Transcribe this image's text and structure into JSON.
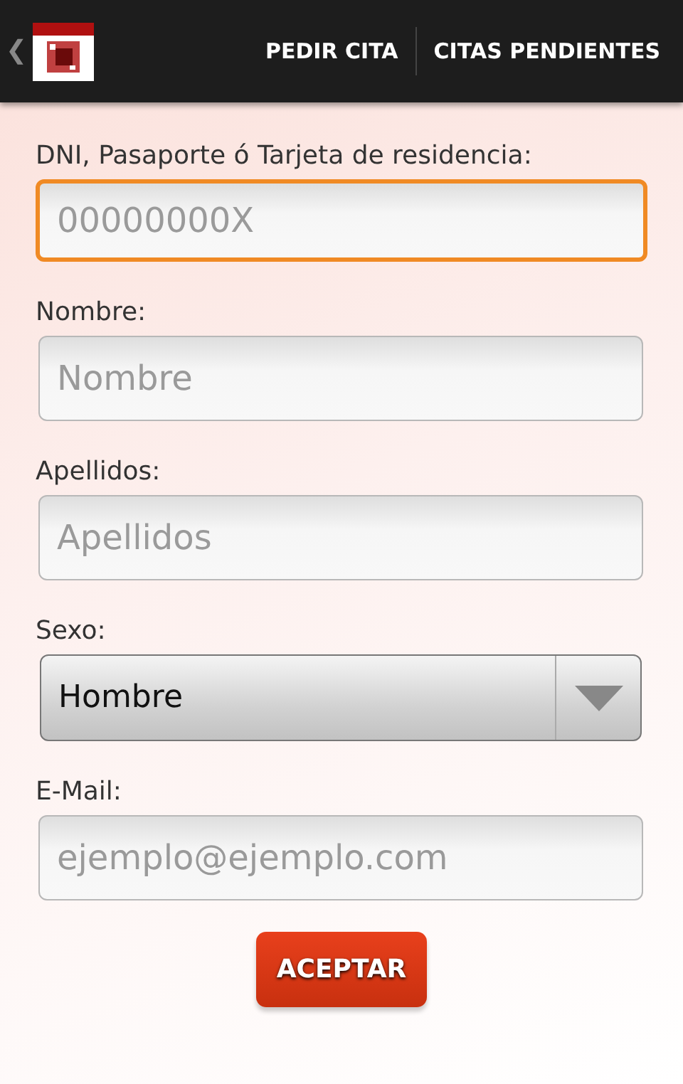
{
  "action_bar": {
    "back": "❮",
    "tabs": [
      {
        "label": "PEDIR CITA"
      },
      {
        "label": "CITAS PENDIENTES"
      }
    ]
  },
  "form": {
    "fields": [
      {
        "kind": "text",
        "label": "DNI, Pasaporte ó Tarjeta de residencia:",
        "placeholder": "00000000X",
        "focused": true
      },
      {
        "kind": "text",
        "label": "Nombre:",
        "placeholder": "Nombre",
        "focused": false
      },
      {
        "kind": "text",
        "label": "Apellidos:",
        "placeholder": "Apellidos",
        "focused": false
      },
      {
        "kind": "select",
        "label": "Sexo:",
        "value": "Hombre"
      },
      {
        "kind": "text",
        "label": "E-Mail:",
        "placeholder": "ejemplo@ejemplo.com",
        "focused": false
      }
    ],
    "submit": "ACEPTAR"
  }
}
